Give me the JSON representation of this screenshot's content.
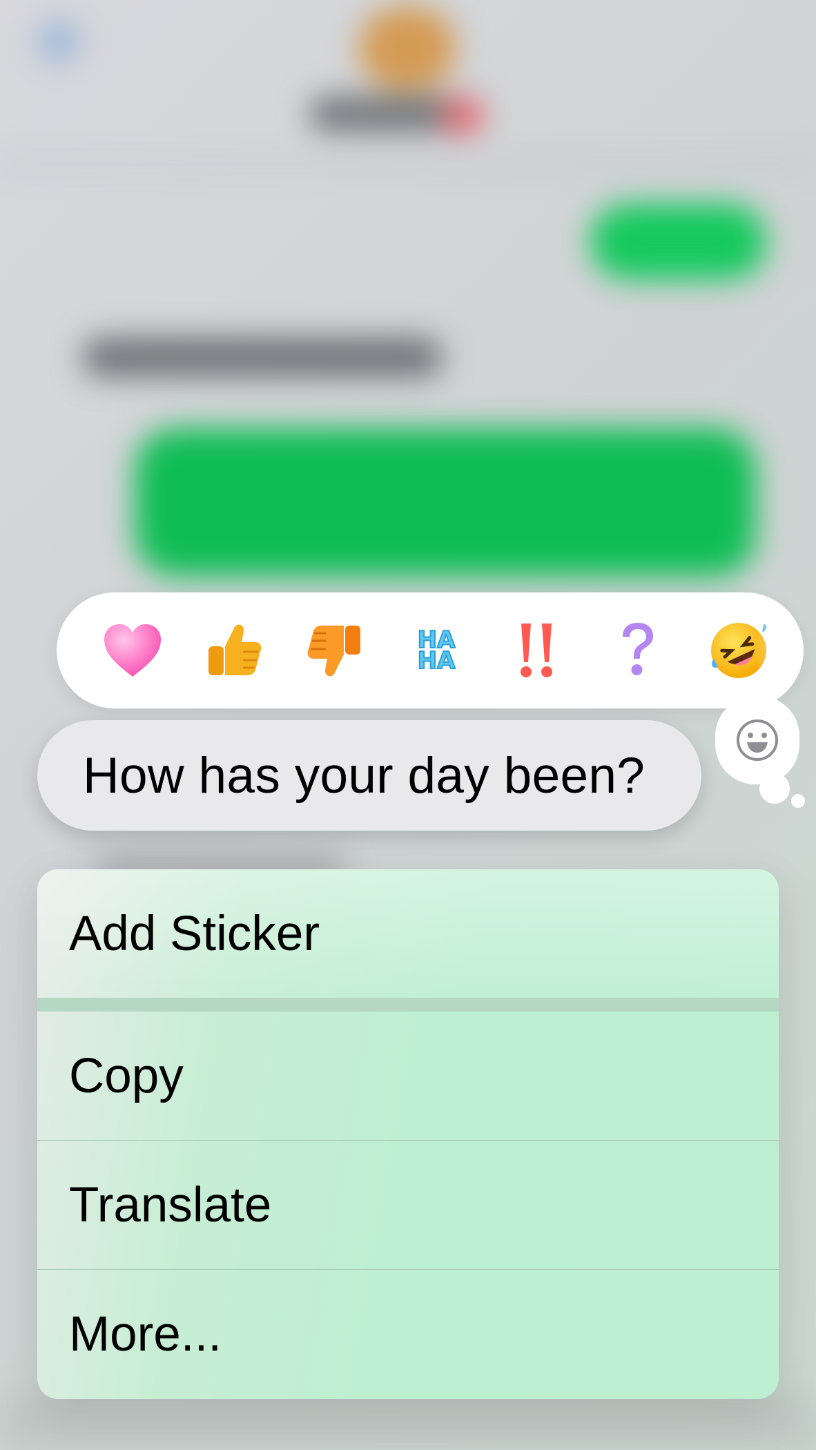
{
  "reactions": [
    {
      "name": "heart",
      "label": ""
    },
    {
      "name": "thumbs-up",
      "label": ""
    },
    {
      "name": "thumbs-down",
      "label": ""
    },
    {
      "name": "haha",
      "label": "HA HA"
    },
    {
      "name": "exclamation",
      "label": "‼"
    },
    {
      "name": "question",
      "label": "?"
    },
    {
      "name": "rolling-laughing",
      "label": ""
    }
  ],
  "haha": {
    "line1": "HA",
    "line2": "HA"
  },
  "message": {
    "text": "How has your day been?"
  },
  "menu": {
    "add_sticker": "Add Sticker",
    "copy": "Copy",
    "translate": "Translate",
    "more": "More..."
  },
  "colors": {
    "message_bubble": "#e9e9eb",
    "menu_tint": "#bdefd2",
    "sent_bubble": "#0fbd55"
  }
}
